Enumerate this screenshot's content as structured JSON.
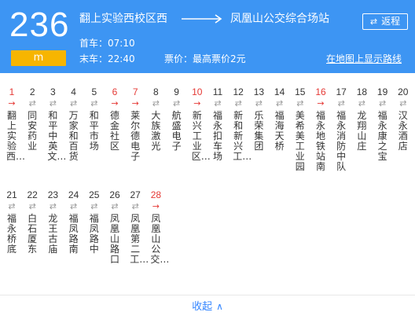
{
  "route": {
    "number": "236",
    "unit": "m",
    "from": "翻上实验西校区西",
    "to": "凤凰山公交综合场站",
    "return_label": "返程",
    "first_bus": "首车：07:10",
    "last_bus": "末车：22:40",
    "fare": "票价：最高票价2元",
    "map_link": "在地图上显示路线"
  },
  "stops": [
    {
      "num": "1",
      "name": "翻上实验西…",
      "highlight": true
    },
    {
      "num": "2",
      "name": "同安药业",
      "highlight": false
    },
    {
      "num": "3",
      "name": "和平中英文…",
      "highlight": false
    },
    {
      "num": "4",
      "name": "万家和百货",
      "highlight": false
    },
    {
      "num": "5",
      "name": "和平市场",
      "highlight": false
    },
    {
      "num": "6",
      "name": "德金社区",
      "highlight": true
    },
    {
      "num": "7",
      "name": "莱尔德电子",
      "highlight": true
    },
    {
      "num": "8",
      "name": "大族激光",
      "highlight": false
    },
    {
      "num": "9",
      "name": "航盛电子",
      "highlight": false
    },
    {
      "num": "10",
      "name": "新兴工业区…",
      "highlight": true
    },
    {
      "num": "11",
      "name": "福永扣车场",
      "highlight": false
    },
    {
      "num": "12",
      "name": "新和新兴工…",
      "highlight": false
    },
    {
      "num": "13",
      "name": "乐荣集团",
      "highlight": false
    },
    {
      "num": "14",
      "name": "福海天桥",
      "highlight": false
    },
    {
      "num": "15",
      "name": "美希美工业园",
      "highlight": false
    },
    {
      "num": "16",
      "name": "福永地铁站南",
      "highlight": true
    },
    {
      "num": "17",
      "name": "福永消防中队",
      "highlight": false
    },
    {
      "num": "18",
      "name": "龙翔山庄",
      "highlight": false
    },
    {
      "num": "19",
      "name": "福永康之宝",
      "highlight": false
    },
    {
      "num": "20",
      "name": "汉永酒店",
      "highlight": false
    },
    {
      "num": "21",
      "name": "福永桥底",
      "highlight": false
    },
    {
      "num": "22",
      "name": "白石厦东",
      "highlight": false
    },
    {
      "num": "23",
      "name": "龙王古庙",
      "highlight": false
    },
    {
      "num": "24",
      "name": "福凤路南",
      "highlight": false
    },
    {
      "num": "25",
      "name": "福凤路中",
      "highlight": false
    },
    {
      "num": "26",
      "name": "凤凰山路口",
      "highlight": false
    },
    {
      "num": "27",
      "name": "凤凰第二工…",
      "highlight": false
    },
    {
      "num": "28",
      "name": "凤凰山公交…",
      "highlight": true
    }
  ],
  "collapse_label": "收起",
  "colors": {
    "header": "#3d95f3",
    "badge": "#f7b500",
    "highlight": "#e53935",
    "link": "#3385ff"
  },
  "icons": {
    "direction_arrow": "long-right-arrow-icon",
    "swap": "swap-arrows-icon",
    "stop_direction": "bidirectional-arrow-icon",
    "collapse": "chevron-up-icon"
  }
}
